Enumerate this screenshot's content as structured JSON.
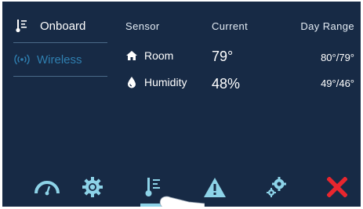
{
  "sidebar": {
    "items": [
      {
        "label": "Onboard",
        "icon": "thermometer-icon",
        "active": true
      },
      {
        "label": "Wireless",
        "icon": "wireless-signal-icon",
        "active": false
      }
    ]
  },
  "table": {
    "headers": {
      "sensor": "Sensor",
      "current": "Current",
      "day_range": "Day Range"
    },
    "rows": [
      {
        "icon": "home-icon",
        "sensor": "Room",
        "current": "79°",
        "day_range": "80°/79°"
      },
      {
        "icon": "water-drop-icon",
        "sensor": "Humidity",
        "current": "48%",
        "day_range": "49°/46°"
      }
    ]
  },
  "bottom_nav": {
    "items": [
      {
        "icon": "gauge-icon"
      },
      {
        "icon": "gear-icon"
      },
      {
        "icon": "thermometer-icon",
        "active": true
      },
      {
        "icon": "warning-icon"
      },
      {
        "icon": "gears-icon"
      },
      {
        "icon": "close-icon"
      }
    ]
  },
  "colors": {
    "background": "#172a45",
    "accent": "#8dd3e8",
    "inactive_text": "#2f7fb0",
    "close": "#e8262e"
  }
}
